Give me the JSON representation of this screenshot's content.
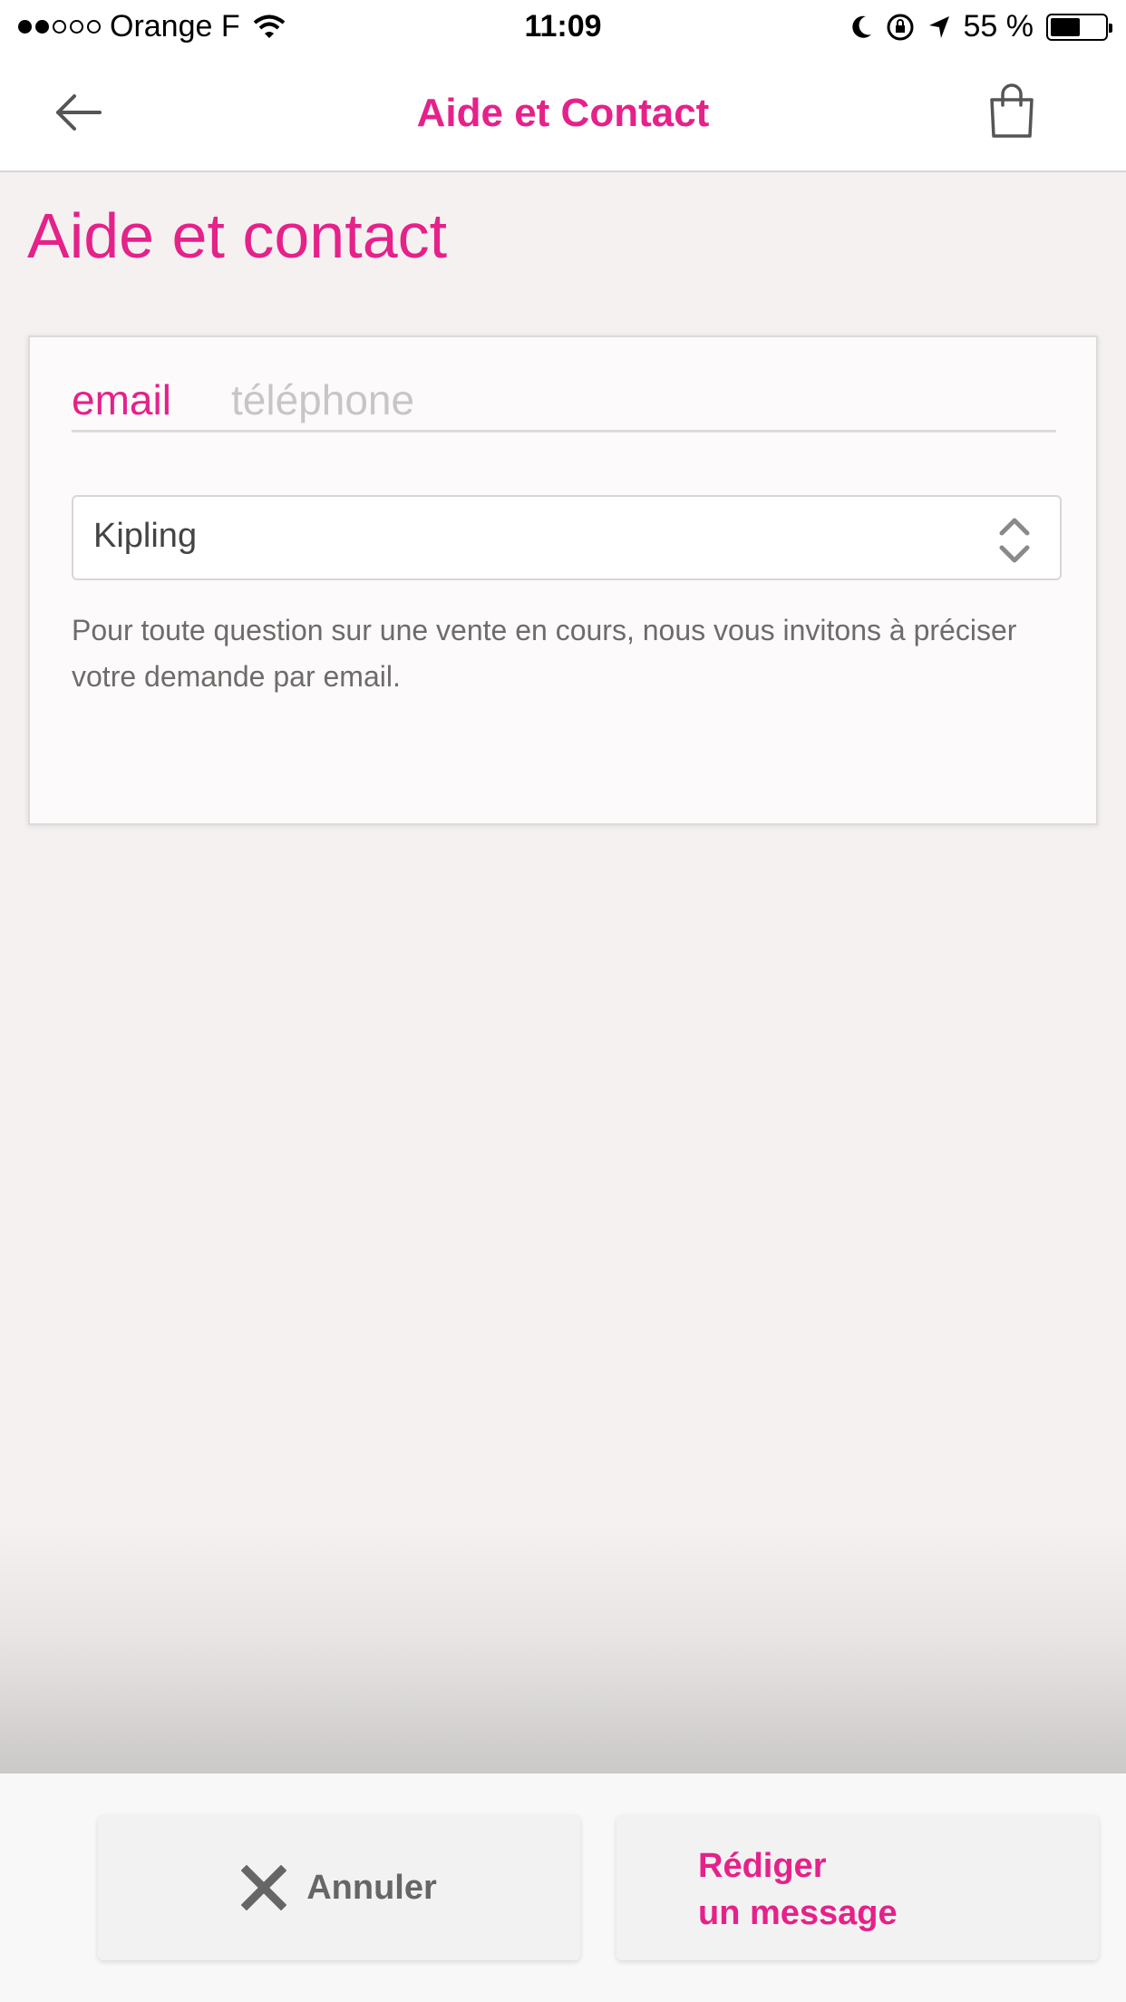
{
  "status_bar": {
    "carrier": "Orange F",
    "time": "11:09",
    "battery_percent": "55 %",
    "battery_level": 0.55,
    "signal_bars_filled": 2,
    "signal_bars_total": 5
  },
  "header": {
    "title": "Aide et Contact",
    "back_icon": "arrow-left-icon",
    "cart_icon": "shopping-bag-icon"
  },
  "page": {
    "title": "Aide et contact"
  },
  "card": {
    "tabs": [
      {
        "label": "email",
        "active": true
      },
      {
        "label": "téléphone",
        "active": false
      }
    ],
    "select": {
      "value": "Kipling",
      "icon": "up-down-chevron-icon"
    },
    "info_text": "Pour toute question sur une vente en cours, nous vous invitons à préciser votre demande par email."
  },
  "actions": {
    "cancel_label": "Annuler",
    "cancel_icon": "close-x-icon",
    "compose_line1": "Rédiger",
    "compose_line2": "un message"
  },
  "colors": {
    "accent": "#e5218a",
    "background": "#f4f1f0",
    "inactive_tab": "#c8c5c5"
  }
}
